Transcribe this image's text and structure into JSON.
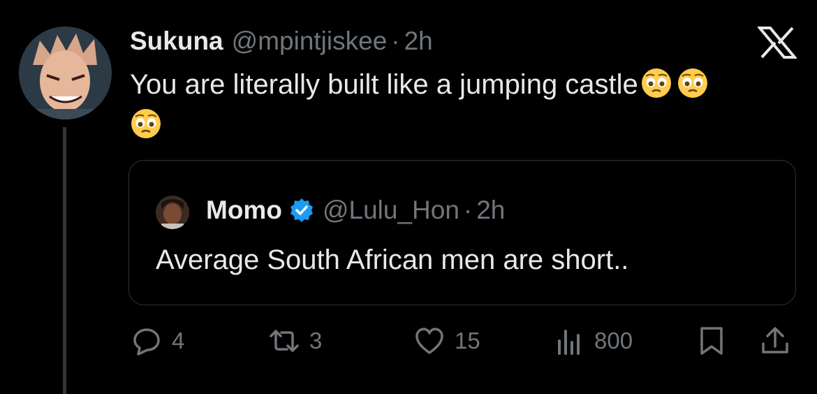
{
  "tweet": {
    "author_name": "Sukuna",
    "author_handle": "@mpintjiskee",
    "separator": "·",
    "time": "2h",
    "text": "You are literally built like a jumping castle",
    "emojis": [
      "pleading-face",
      "pleading-face",
      "pleading-face"
    ]
  },
  "quote": {
    "author_name": "Momo",
    "verified": true,
    "author_handle": "@Lulu_Hon",
    "separator": "·",
    "time": "2h",
    "text": "Average South African men are short.."
  },
  "actions": {
    "replies": "4",
    "retweets": "3",
    "likes": "15",
    "views": "800"
  },
  "colors": {
    "background": "#000000",
    "text_primary": "#e7e9ea",
    "text_secondary": "#71767b",
    "verified_blue": "#1d9bf0",
    "border": "#2f3336"
  },
  "icons": [
    "x-logo",
    "reply-icon",
    "retweet-icon",
    "like-icon",
    "views-icon",
    "bookmark-icon",
    "share-icon",
    "verified-badge-icon"
  ]
}
